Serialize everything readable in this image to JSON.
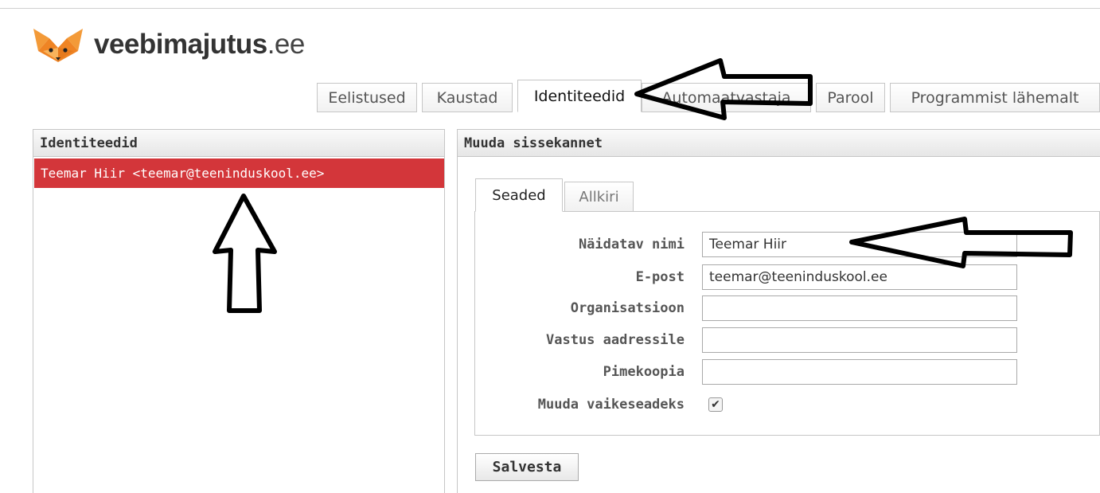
{
  "logo": {
    "brand": "veebimajutus",
    "tld": ".ee"
  },
  "tabs": [
    {
      "label": "Eelistused"
    },
    {
      "label": "Kaustad"
    },
    {
      "label": "Identiteedid"
    },
    {
      "label": "Automaatvastaja"
    },
    {
      "label": "Parool"
    },
    {
      "label": "Programmist lähemalt"
    }
  ],
  "identities": {
    "header": "Identiteedid",
    "items": [
      {
        "label": "Teemar Hiir <teemar@teeninduskool.ee>"
      }
    ]
  },
  "edit": {
    "header": "Muuda sissekannet",
    "subtabs": [
      {
        "label": "Seaded"
      },
      {
        "label": "Allkiri"
      }
    ],
    "fields": {
      "display_name": {
        "label": "Näidatav nimi",
        "value": "Teemar Hiir"
      },
      "email": {
        "label": "E-post",
        "value": "teemar@teeninduskool.ee"
      },
      "organization": {
        "label": "Organisatsioon",
        "value": ""
      },
      "reply_to": {
        "label": "Vastus aadressile",
        "value": ""
      },
      "bcc": {
        "label": "Pimekoopia",
        "value": ""
      },
      "set_default": {
        "label": "Muuda vaikeseadeks",
        "checked": true
      }
    },
    "save_label": "Salvesta"
  },
  "colors": {
    "selected_row": "#d3363a",
    "logo_orange": "#f0892c"
  }
}
